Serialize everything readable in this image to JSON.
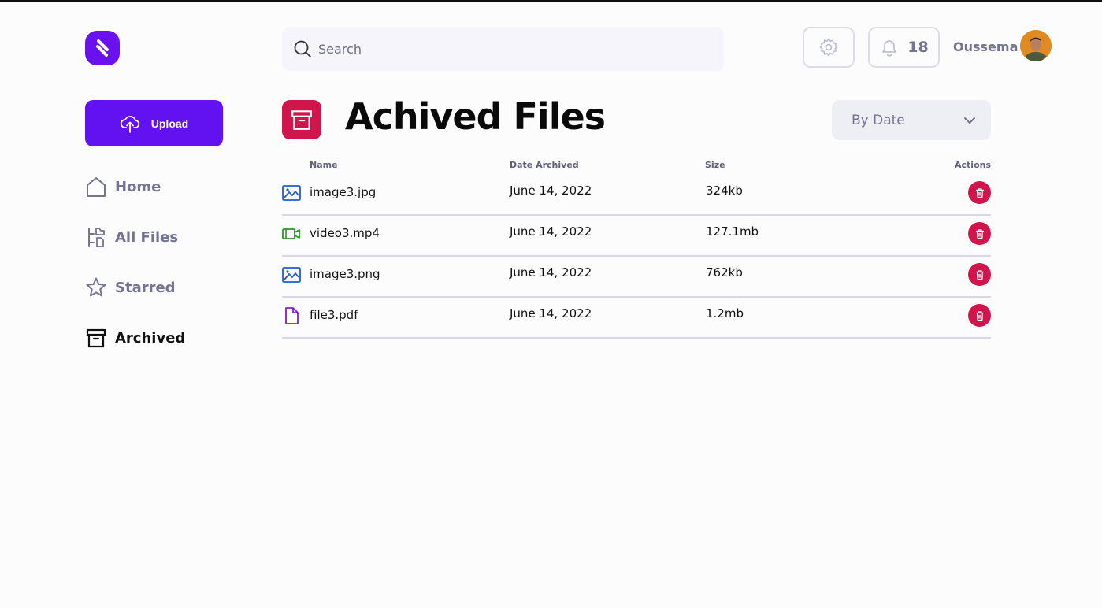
{
  "sidebar": {
    "upload_label": "Upload",
    "items": [
      {
        "label": "Home",
        "icon": "home-icon"
      },
      {
        "label": "All Files",
        "icon": "all-files-icon"
      },
      {
        "label": "Starred",
        "icon": "star-icon"
      },
      {
        "label": "Archived",
        "icon": "archive-icon",
        "active": true
      }
    ]
  },
  "header": {
    "search_placeholder": "Search",
    "notification_count": "18",
    "user_name": "Oussema"
  },
  "page": {
    "title": "Achived Files",
    "sort_label": "By Date"
  },
  "table": {
    "columns": {
      "name": "Name",
      "date": "Date Archived",
      "size": "Size",
      "actions": "Actions"
    },
    "rows": [
      {
        "name": "image3.jpg",
        "date": "June 14, 2022",
        "size": "324kb",
        "type": "image",
        "icon": "image-icon"
      },
      {
        "name": "video3.mp4",
        "date": "June 14, 2022",
        "size": "127.1mb",
        "type": "video",
        "icon": "video-icon"
      },
      {
        "name": "image3.png",
        "date": "June 14, 2022",
        "size": "762kb",
        "type": "image",
        "icon": "image-icon"
      },
      {
        "name": "file3.pdf",
        "date": "June 14, 2022",
        "size": "1.2mb",
        "type": "document",
        "icon": "document-icon"
      }
    ]
  },
  "colors": {
    "brand": "#6211f0",
    "archive_accent": "#d0154c",
    "muted_text": "#737590",
    "image_icon": "#1a5fd0",
    "video_icon": "#1f9a1f",
    "document_icon": "#7b1fd6"
  }
}
